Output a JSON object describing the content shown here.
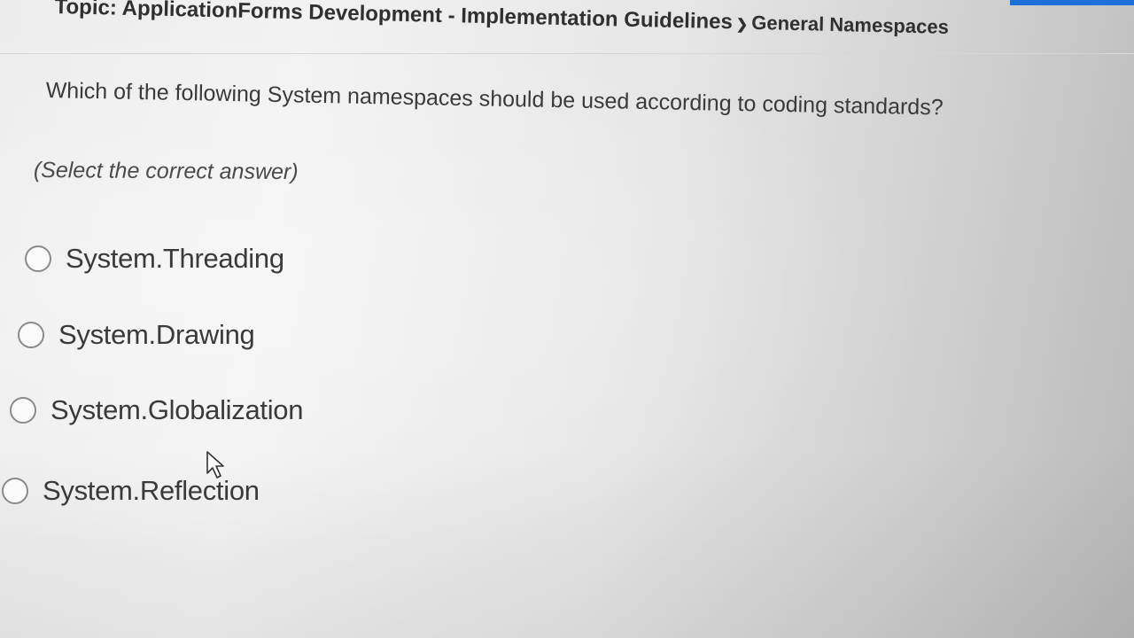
{
  "header": {
    "topic_prefix": "Topic: ApplicationForms Development - Implementation Guidelines",
    "breadcrumb_separator_icon": "chevron-right-icon",
    "current_section": "General Namespaces",
    "accent_color": "#1e6fd9"
  },
  "question": {
    "text": "Which of the following System namespaces should be used according to coding standards?",
    "instruction": "(Select the correct answer)"
  },
  "options": [
    {
      "label": "System.Threading",
      "selected": false
    },
    {
      "label": "System.Drawing",
      "selected": false
    },
    {
      "label": "System.Globalization",
      "selected": false
    },
    {
      "label": "System.Reflection",
      "selected": false
    }
  ]
}
